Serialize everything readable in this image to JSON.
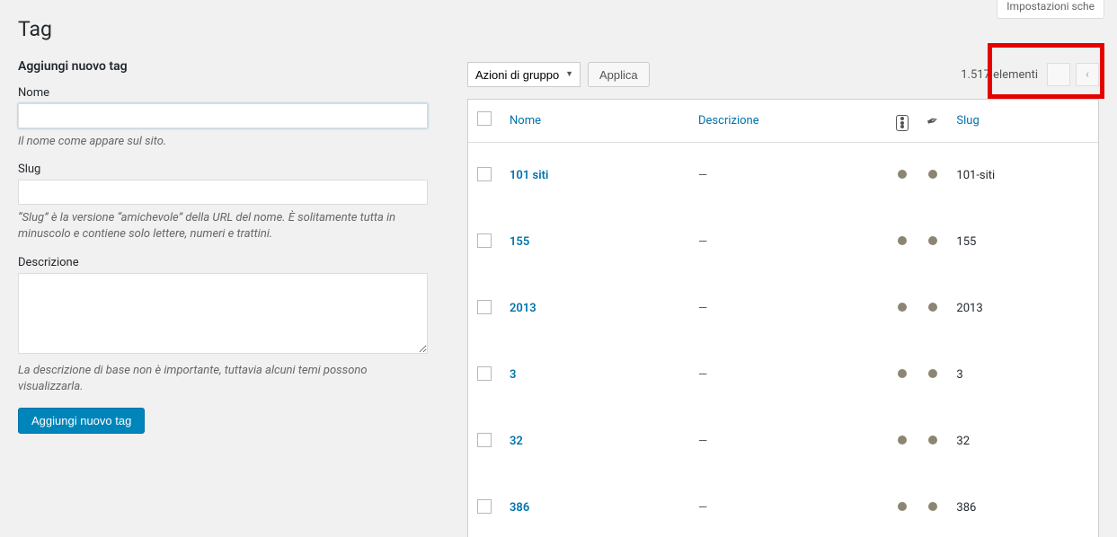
{
  "header": {
    "page_title": "Tag",
    "screen_options": "Impostazioni sche"
  },
  "form": {
    "heading": "Aggiungi nuovo tag",
    "name": {
      "label": "Nome",
      "value": "",
      "desc": "Il nome come appare sul sito."
    },
    "slug": {
      "label": "Slug",
      "value": "",
      "desc": "“Slug” è la versione “amichevole” della URL del nome. È solitamente tutta in minuscolo e contiene solo lettere, numeri e trattini."
    },
    "description": {
      "label": "Descrizione",
      "value": "",
      "desc": "La descrizione di base non è importante, tuttavia alcuni temi possono visualizzarla."
    },
    "submit_label": "Aggiungi nuovo tag"
  },
  "list": {
    "bulk_action_label": "Azioni di gruppo",
    "apply_label": "Applica",
    "items_count_label": "1.517 elementi",
    "columns": {
      "name": "Nome",
      "description": "Descrizione",
      "slug": "Slug"
    },
    "rows": [
      {
        "name": "101 siti",
        "description": "—",
        "slug": "101-siti"
      },
      {
        "name": "155",
        "description": "—",
        "slug": "155"
      },
      {
        "name": "2013",
        "description": "—",
        "slug": "2013"
      },
      {
        "name": "3",
        "description": "—",
        "slug": "3"
      },
      {
        "name": "32",
        "description": "—",
        "slug": "32"
      },
      {
        "name": "386",
        "description": "—",
        "slug": "386"
      }
    ]
  }
}
